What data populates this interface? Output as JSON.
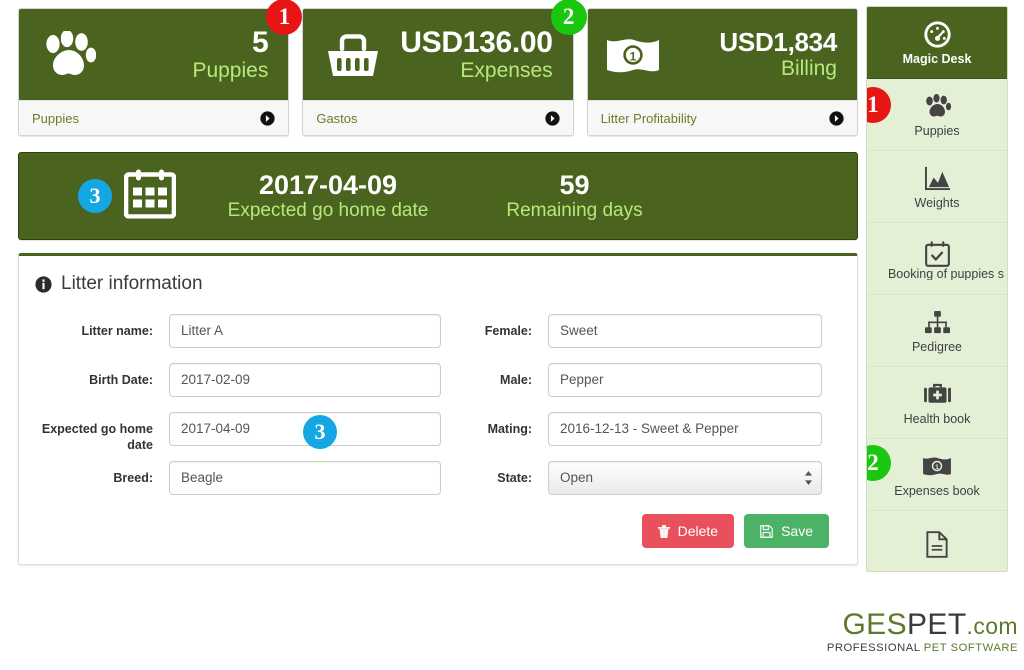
{
  "kpi_cards": [
    {
      "icon": "paw-print-icon",
      "value": "5",
      "label": "Puppies",
      "footer_label": "Puppies",
      "footer_arrow_icon": "arrow-circle-right-icon",
      "badge": {
        "text": "1",
        "color": "#e81515"
      }
    },
    {
      "icon": "shopping-basket-icon",
      "value": "USD136.00",
      "label": "Expenses",
      "footer_label": "Gastos",
      "footer_arrow_icon": "arrow-circle-right-icon",
      "badge": {
        "text": "2",
        "color": "#18c70e"
      }
    },
    {
      "icon": "banknote-icon",
      "value": "USD1,834",
      "label": "Billing",
      "footer_label": "Litter Profitability",
      "footer_arrow_icon": "arrow-circle-right-icon",
      "badge": {
        "text": "",
        "color": ""
      }
    }
  ],
  "date_banner": {
    "calendar_icon": "calendar-icon",
    "badge": {
      "text": "3",
      "color": "#15a7e3"
    },
    "date_value": "2017-04-09",
    "date_label": "Expected go home date",
    "days_value": "59",
    "days_label": "Remaining days"
  },
  "panel": {
    "icon": "info-circle-icon",
    "title": "Litter information",
    "left_fields": [
      {
        "label": "Litter name:",
        "value": "Litter A",
        "type": "text"
      },
      {
        "label": "Birth Date:",
        "value": "2017-02-09",
        "type": "text"
      },
      {
        "label": "Expected go home date",
        "value": "2017-04-09",
        "type": "text",
        "badge": {
          "text": "3",
          "color": "#15a7e3"
        }
      },
      {
        "label": "Breed:",
        "value": "Beagle",
        "type": "text"
      }
    ],
    "right_fields": [
      {
        "label": "Female:",
        "value": "Sweet",
        "type": "text"
      },
      {
        "label": "Male:",
        "value": "Pepper",
        "type": "text"
      },
      {
        "label": "Mating:",
        "value": "2016-12-13 - Sweet & Pepper",
        "type": "text"
      },
      {
        "label": "State:",
        "value": "Open",
        "type": "select"
      }
    ],
    "buttons": {
      "delete_label": "Delete",
      "delete_icon": "trash-icon",
      "save_label": "Save",
      "save_icon": "floppy-disk-icon"
    }
  },
  "sidebar": {
    "items": [
      {
        "icon": "dashboard-gauge-icon",
        "label": "Magic Desk",
        "active": true
      },
      {
        "icon": "paw-print-icon",
        "label": "Puppies",
        "active": false,
        "badge": {
          "text": "1",
          "color": "#e81515"
        }
      },
      {
        "icon": "area-chart-icon",
        "label": "Weights",
        "active": false
      },
      {
        "icon": "calendar-check-icon",
        "label": "Booking of puppies s",
        "active": false,
        "truncated": true
      },
      {
        "icon": "sitemap-icon",
        "label": "Pedigree",
        "active": false
      },
      {
        "icon": "medical-kit-icon",
        "label": "Health book",
        "active": false
      },
      {
        "icon": "banknote-icon",
        "label": "Expenses book",
        "active": false,
        "badge": {
          "text": "2",
          "color": "#18c70e"
        }
      },
      {
        "icon": "document-icon",
        "label": "",
        "active": false
      }
    ]
  },
  "logo": {
    "part1": "GES",
    "part2": "PET",
    "part3": ".com",
    "tagline_part1": "PROFESSIONAL",
    "tagline_part2": " PET SOFTWARE"
  },
  "colors": {
    "brand_green": "#4a6420",
    "accent_light_green": "#b6e87a",
    "sidebar_bg": "#e4f0d6",
    "danger": "#e8505b",
    "success": "#4cb265",
    "badge_red": "#e81515",
    "badge_green": "#18c70e",
    "badge_blue": "#15a7e3"
  }
}
